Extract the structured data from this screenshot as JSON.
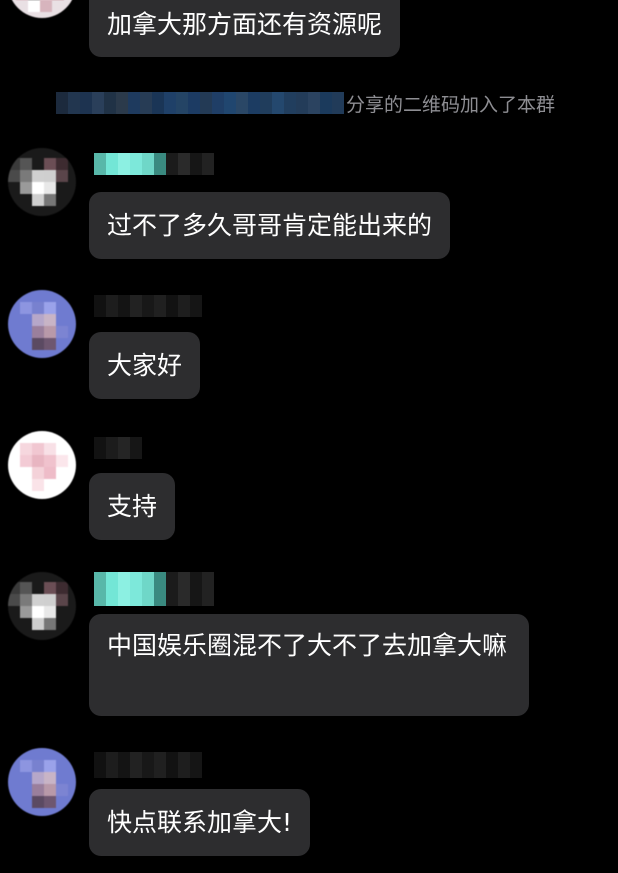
{
  "messages": [
    {
      "id": "m0",
      "text": "加拿大那方面还有资源呢"
    },
    {
      "id": "m1",
      "text": "过不了多久哥哥肯定能出来的"
    },
    {
      "id": "m2",
      "text": "大家好"
    },
    {
      "id": "m3",
      "text": "支持"
    },
    {
      "id": "m4",
      "text": "中国娱乐圈混不了大不了去加拿大嘛"
    },
    {
      "id": "m5",
      "text": "快点联系加拿大!"
    }
  ],
  "system_notice": {
    "text": "分享的二维码加入了本群"
  },
  "colors": {
    "background": "#000000",
    "bubble": "#2d2d2f",
    "text": "#ffffff",
    "system_text": "#8e8e93",
    "name_accent": "#5fe3d0"
  }
}
